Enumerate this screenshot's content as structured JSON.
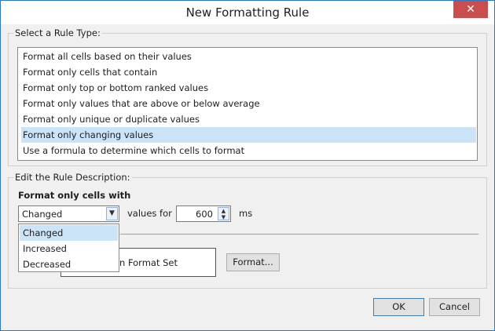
{
  "window": {
    "title": "New Formatting Rule",
    "close_glyph": "✕"
  },
  "rule_type": {
    "label": "Select a Rule Type:",
    "items": [
      "Format all cells based on their values",
      "Format only cells that contain",
      "Format only top or bottom ranked values",
      "Format only values that are above or below average",
      "Format only unique or duplicate values",
      "Format only changing values",
      "Use a formula to determine which cells to format"
    ],
    "selected_index": 5
  },
  "description": {
    "label": "Edit the Rule Description:",
    "heading": "Format only cells with",
    "change_combo": {
      "value": "Changed",
      "options": [
        "Changed",
        "Increased",
        "Decreased"
      ],
      "selected_index": 0
    },
    "values_for_label": "values for",
    "duration_value": "600",
    "unit_label": "ms",
    "preview_text": "n Format Set",
    "format_button": "Format..."
  },
  "footer": {
    "ok": "OK",
    "cancel": "Cancel"
  },
  "icons": {
    "combo_arrow": "chevron-down-icon",
    "spin": "spinner-arrows-icon",
    "close": "close-icon"
  },
  "colors": {
    "selection": "#cce4f7",
    "close_bg": "#c94f4f",
    "border_accent": "#2b78c6"
  }
}
